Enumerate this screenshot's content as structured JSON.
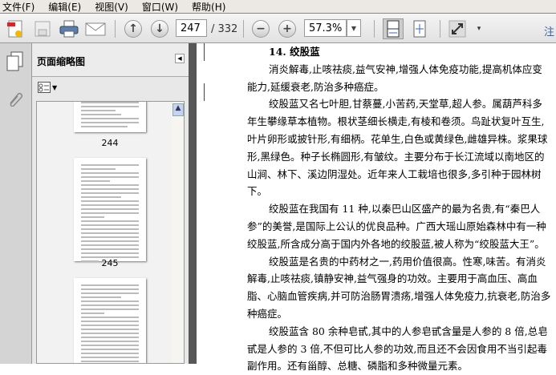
{
  "menu": [
    "文件(F)",
    "编辑(E)",
    "视图(V)",
    "窗口(W)",
    "帮助(H)"
  ],
  "toolbar": {
    "page_current": "247",
    "page_total": "/ 332",
    "zoom": "57.3%",
    "right_label": "注"
  },
  "panel": {
    "title": "页面缩略图",
    "thumbnails": [
      {
        "label": "244"
      },
      {
        "label": "245"
      },
      {
        "label": ""
      }
    ]
  },
  "document": {
    "heading": "14. 绞股蓝",
    "paragraphs": [
      "消炎解毒,止咳祛痰,益气安神,增强人体免疫功能,提高机体应变能力,延缓衰老,防治多种癌症。",
      "绞股蓝又名七叶胆,甘蔡蔓,小苦药,天堂草,超人参。属葫芦科多年生攀缘草本植物。根状茎细长横走,有棱和卷须。鸟趾状复叶互生,叶片卵形或披针形,有细柄。花单生,白色或黄绿色,雌雄异株。浆果球形,黑绿色。种子长椭圆形,有皱纹。主要分布于长江流域以南地区的山涧、林下、溪边阴湿处。近年来人工栽培也很多,多引种于园林树下。",
      "绞股蓝在我国有 11 种,以秦巴山区盛产的最为名贵,有“秦巴人参”的美誉,是国际上公认的优良品种。广西大瑶山原始森林中有一种绞股蓝,所含成分高于国内外各地的绞股蓝,被人称为“绞股蓝大王”。",
      "绞股蓝是名贵的中药材之一,药用价值很高。性寒,味苦。有消炎解毒,止咳祛痰,镇静安神,益气强身的功效。主要用于高血压、高血脂、心脑血管疾病,并可防治肠胃溃疡,增强人体免疫力,抗衰老,防治多种癌症。",
      "绞股蓝含 80 余种皂甙,其中的人参皂甙含量是人参的 8 倍,总皂甙是人参的 3 倍,不但可比人参的功效,而且还不会因食用不当引起毒副作用。还有甾醇、总糖、磷脂和多种微量元素。"
    ]
  }
}
